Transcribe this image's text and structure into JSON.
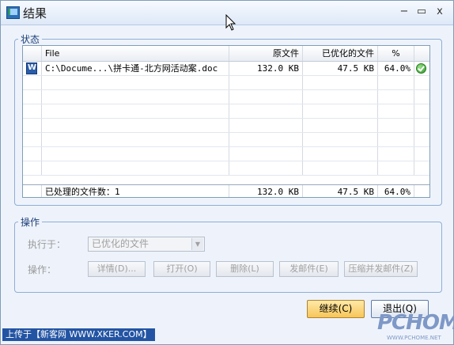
{
  "window": {
    "title": "结果",
    "minimize_glyph": "−",
    "maximize_glyph": "▭",
    "close_glyph": "x"
  },
  "status_group": {
    "legend": "状态",
    "columns": [
      "File",
      "原文件",
      "已优化的文件",
      "%"
    ],
    "rows": [
      {
        "file": "C:\\Docume...\\拼卡通-北方网活动案.doc",
        "original": "132.0 KB",
        "optimized": "47.5 KB",
        "percent": "64.0%",
        "file_icon": "word-doc-icon",
        "status_icon": "checkmark-icon"
      }
    ],
    "footer": {
      "label": "已处理的文件数：1",
      "original": "132.0 KB",
      "optimized": "47.5 KB",
      "percent": "64.0%"
    }
  },
  "ops_group": {
    "legend": "操作",
    "execute_label": "执行于：",
    "execute_value": "已优化的文件",
    "actions_label": "操作：",
    "actions": [
      "详情(D)...",
      "打开(O)",
      "删除(L)",
      "发邮件(E)",
      "压缩并发邮件(Z)"
    ]
  },
  "buttons": {
    "continue": "继续(C)",
    "exit": "退出(Q)"
  },
  "watermark": {
    "upload_note": "上传于【新客网 WWW.XKER.COM】",
    "logo": "PCHOME",
    "logo_url": "WWW.PCHOME.NET"
  },
  "colors": {
    "accent": "#2354a3",
    "primary_button": "#f7c65a"
  }
}
